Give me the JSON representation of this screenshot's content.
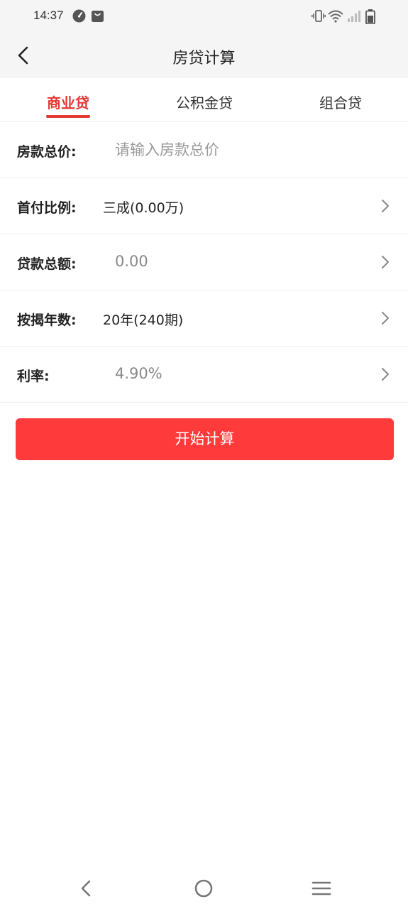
{
  "status_bar": {
    "time": "14:37",
    "icons": [
      "speedometer-icon",
      "bag-icon",
      "vibrate-icon",
      "wifi-icon",
      "signal-icon",
      "battery-icon"
    ]
  },
  "header": {
    "title": "房贷计算",
    "back_icon": "back-arrow-icon"
  },
  "tabs": [
    {
      "label": "商业贷",
      "active": true
    },
    {
      "label": "公积金贷",
      "active": false
    },
    {
      "label": "组合贷",
      "active": false
    }
  ],
  "form": {
    "total_price": {
      "label": "房款总价:",
      "placeholder": "请输入房款总价",
      "value": ""
    },
    "down_payment": {
      "label": "首付比例:",
      "value": "三成(0.00万)"
    },
    "loan_total": {
      "label": "贷款总额:",
      "value": "0.00"
    },
    "loan_years": {
      "label": "按揭年数:",
      "value": "20年(240期)"
    },
    "rate": {
      "label": "利率:",
      "value": "4.90%"
    }
  },
  "actions": {
    "calculate_label": "开始计算"
  },
  "colors": {
    "accent": "#e53935",
    "button": "#ff3a3a",
    "header_bg": "#f5f5f5"
  },
  "nav": {
    "icons": [
      "nav-back-icon",
      "nav-home-icon",
      "nav-menu-icon"
    ]
  }
}
